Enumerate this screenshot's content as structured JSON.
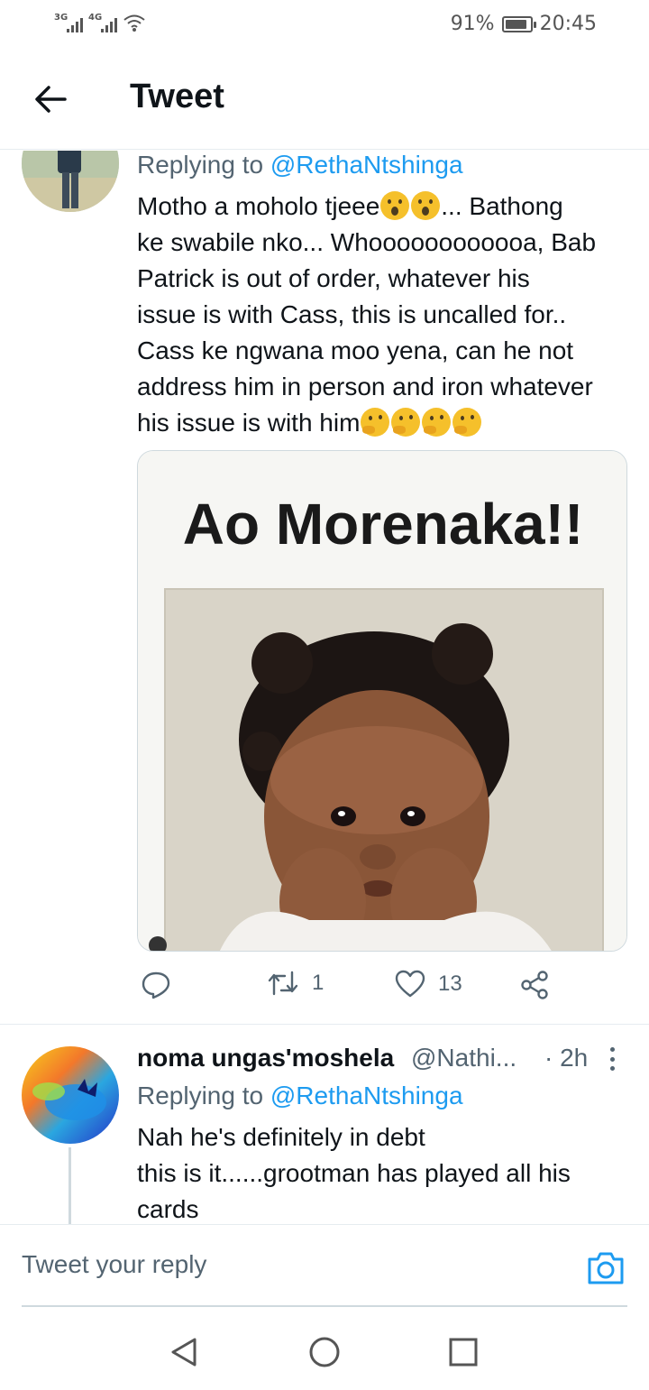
{
  "status_bar": {
    "network1": "3G",
    "network2": "4G",
    "battery_percent": "91%",
    "battery_level": 0.91,
    "time": "20:45",
    "icons": [
      "signal-icon",
      "signal-icon",
      "wifi-icon",
      "battery-icon"
    ]
  },
  "header": {
    "back_icon": "back-arrow-icon",
    "title": "Tweet"
  },
  "tweet1": {
    "replying_prefix": "Replying to",
    "replying_handle": "@RethaNtshinga",
    "lines": [
      {
        "before": "Motho a moholo tjeee",
        "emoji": [
          "astonished",
          "astonished"
        ],
        "after": "... Bathong"
      },
      {
        "before": "ke swabile nko... Whoooooooooooa, Bab",
        "emoji": [],
        "after": ""
      },
      {
        "before": "Patrick is out of order, whatever his",
        "emoji": [],
        "after": ""
      },
      {
        "before": "issue is with Cass, this is uncalled for..",
        "emoji": [],
        "after": ""
      },
      {
        "before": "Cass ke ngwana moo yena, can he not",
        "emoji": [],
        "after": ""
      },
      {
        "before": "address him in person and iron whatever",
        "emoji": [],
        "after": ""
      },
      {
        "before": "his issue is with him",
        "emoji": [
          "thinking",
          "thinking",
          "thinking",
          "thinking"
        ],
        "after": ""
      }
    ],
    "media_caption": "Ao Morenaka!!",
    "actions": {
      "reply_count": "",
      "retweet_count": "1",
      "like_count": "13",
      "icons": [
        "reply-icon",
        "retweet-icon",
        "like-icon",
        "share-icon"
      ]
    }
  },
  "tweet2": {
    "name": "noma ungas'moshela",
    "handle": "@Nathi...",
    "time": "· 2h",
    "replying_prefix": "Replying to",
    "replying_handle": "@RethaNtshinga",
    "lines": [
      "Nah he's definitely in debt",
      "this is it......grootman has played all his",
      "cards"
    ]
  },
  "reply_bar": {
    "placeholder": "Tweet your reply",
    "camera_icon": "camera-icon"
  },
  "nav": {
    "icons": [
      "nav-back-icon",
      "nav-home-icon",
      "nav-recents-icon"
    ]
  },
  "colors": {
    "link": "#1d9bf0",
    "text": "#0f1419",
    "secondary": "#536471",
    "divider": "#e6ecf0"
  }
}
